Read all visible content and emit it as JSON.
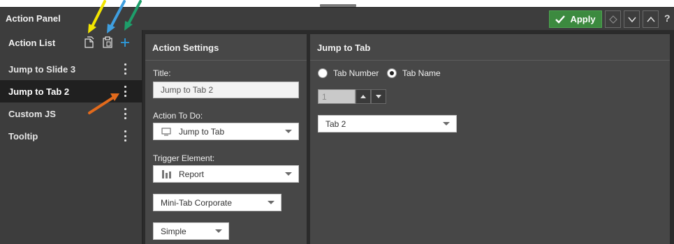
{
  "panel": {
    "title": "Action Panel"
  },
  "toolbar": {
    "apply_label": "Apply",
    "help_label": "?"
  },
  "action_list": {
    "title": "Action List",
    "items": [
      {
        "label": "Jump to Slide 3"
      },
      {
        "label": "Jump to Tab 2"
      },
      {
        "label": "Custom JS"
      },
      {
        "label": "Tooltip"
      }
    ],
    "active_index": 1
  },
  "action_settings": {
    "title": "Action Settings",
    "title_label": "Title:",
    "title_value": "Jump to Tab 2",
    "action_label": "Action To Do:",
    "action_value": "Jump to Tab",
    "trigger_label": "Trigger Element:",
    "trigger_value": "Report",
    "theme_value": "Mini-Tab Corporate",
    "style_value": "Simple"
  },
  "jump_to_tab": {
    "title": "Jump to Tab",
    "option_number": "Tab Number",
    "option_name": "Tab Name",
    "selected_option": "Tab Name",
    "number_value": "1",
    "tab_value": "Tab 2"
  },
  "colors": {
    "apply_green": "#3c8a3f",
    "copy_arrow": "#f2e500",
    "paste_arrow": "#3f9fe0",
    "add_arrow": "#1e9e6a",
    "kebab_arrow": "#e26a1c",
    "add_icon": "#2d9de0"
  }
}
